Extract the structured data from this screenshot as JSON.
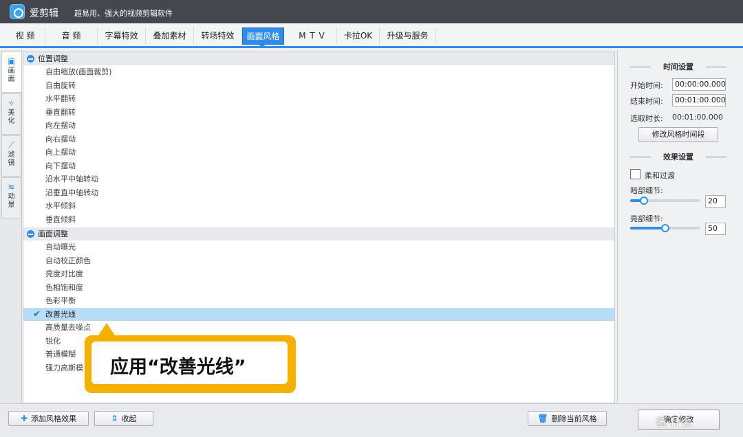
{
  "app": {
    "title": "爱剪辑",
    "subtitle": "超易用、强大的视频剪辑软件"
  },
  "tabs": [
    {
      "label": "视  频"
    },
    {
      "label": "音  频"
    },
    {
      "label": "字幕特效"
    },
    {
      "label": "叠加素材"
    },
    {
      "label": "转场特效"
    },
    {
      "label": "画面风格"
    },
    {
      "label": "M T V"
    },
    {
      "label": "卡拉OK"
    },
    {
      "label": "升级与服务"
    }
  ],
  "active_tab": "画面风格",
  "side_tabs": [
    {
      "label": "画面"
    },
    {
      "label": "美化"
    },
    {
      "label": "滤镜"
    },
    {
      "label": "动景"
    }
  ],
  "groups": {
    "position": {
      "label": "位置调整",
      "items": [
        "自由缩放(画面裁剪)",
        "自由旋转",
        "水平翻转",
        "垂直翻转",
        "向左摆动",
        "向右摆动",
        "向上摆动",
        "向下摆动",
        "沿水平中轴转动",
        "沿垂直中轴转动",
        "水平倾斜",
        "垂直倾斜"
      ]
    },
    "picture": {
      "label": "画面调整",
      "items": [
        "自动曝光",
        "自动校正颜色",
        "亮度对比度",
        "色相饱和度",
        "色彩平衡",
        "改善光线",
        "高质量去噪点",
        "锐化",
        "普通模糊",
        "强力高斯模"
      ]
    }
  },
  "selected_item": "改善光线",
  "callout": {
    "text": "应用“改善光线”"
  },
  "right_panel": {
    "time_section": "时间设置",
    "start_label": "开始时间:",
    "start_value": "00:00:00.000",
    "end_label": "结束时间:",
    "end_value": "00:01:00.000",
    "duration_label": "选取时长:",
    "duration_value": "00:01:00.000",
    "modify_button": "修改风格时间段",
    "effect_section": "效果设置",
    "soft_transition": "柔和过渡",
    "soft_checked": false,
    "dark_label": "暗部细节:",
    "dark_value": "20",
    "dark_level": 0.2,
    "bright_label": "亮部细节:",
    "bright_value": "50",
    "bright_level": 0.5
  },
  "bottom": {
    "add_button": "添加风格效果",
    "collapse_button": "收起",
    "delete_button": "删除当前风格",
    "confirm_button": "确定修改"
  },
  "watermark": "值 什么",
  "colors": {
    "accent": "#2e8de6",
    "callout": "#f5b100",
    "selected_row": "#b9dcf7",
    "titlebar": "#44474d"
  }
}
